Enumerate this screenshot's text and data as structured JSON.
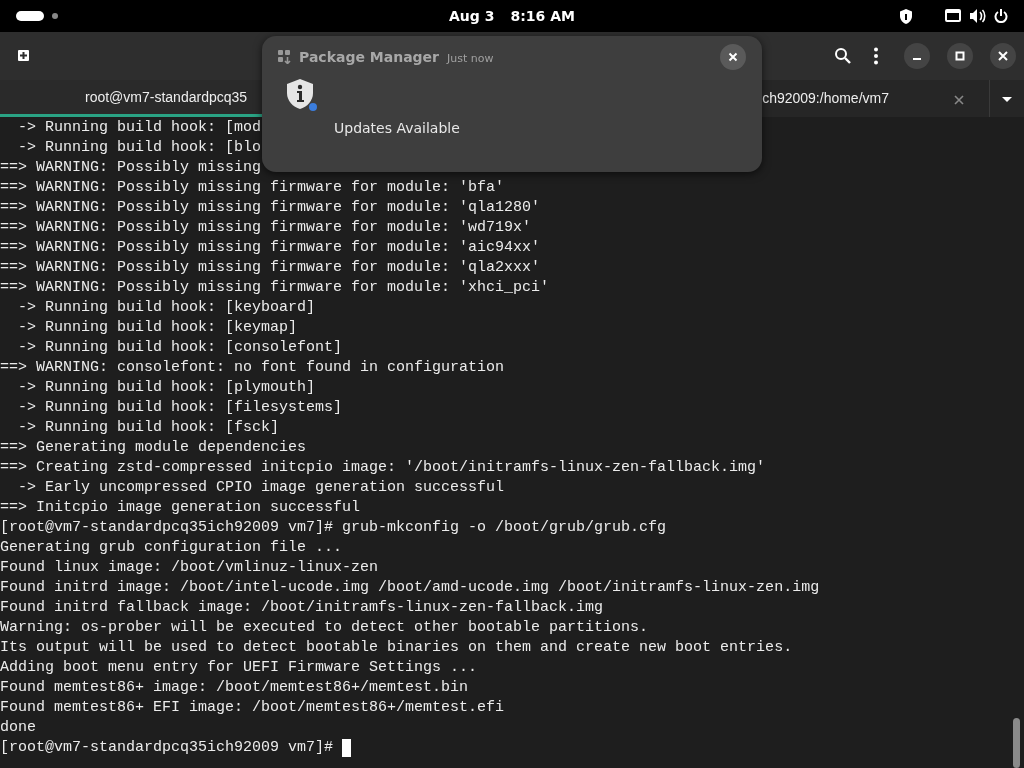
{
  "top_bar": {
    "date": "Aug 3",
    "time": "8:16 AM"
  },
  "tabs": [
    {
      "title": "root@vm7-standardpcq35",
      "selected": true
    },
    {
      "title": "ch92009:/home/vm7",
      "selected": false
    }
  ],
  "terminal": {
    "lines": [
      "  -> Running build hook: [mod",
      "  -> Running build hook: [blo",
      "==> WARNING: Possibly missing",
      "==> WARNING: Possibly missing firmware for module: 'bfa'",
      "==> WARNING: Possibly missing firmware for module: 'qla1280'",
      "==> WARNING: Possibly missing firmware for module: 'wd719x'",
      "==> WARNING: Possibly missing firmware for module: 'aic94xx'",
      "==> WARNING: Possibly missing firmware for module: 'qla2xxx'",
      "==> WARNING: Possibly missing firmware for module: 'xhci_pci'",
      "  -> Running build hook: [keyboard]",
      "  -> Running build hook: [keymap]",
      "  -> Running build hook: [consolefont]",
      "==> WARNING: consolefont: no font found in configuration",
      "  -> Running build hook: [plymouth]",
      "  -> Running build hook: [filesystems]",
      "  -> Running build hook: [fsck]",
      "==> Generating module dependencies",
      "==> Creating zstd-compressed initcpio image: '/boot/initramfs-linux-zen-fallback.img'",
      "  -> Early uncompressed CPIO image generation successful",
      "==> Initcpio image generation successful",
      "[root@vm7-standardpcq35ich92009 vm7]# grub-mkconfig -o /boot/grub/grub.cfg",
      "Generating grub configuration file ...",
      "Found linux image: /boot/vmlinuz-linux-zen",
      "Found initrd image: /boot/intel-ucode.img /boot/amd-ucode.img /boot/initramfs-linux-zen.img",
      "Found initrd fallback image: /boot/initramfs-linux-zen-fallback.img",
      "Warning: os-prober will be executed to detect other bootable partitions.",
      "Its output will be used to detect bootable binaries on them and create new boot entries.",
      "Adding boot menu entry for UEFI Firmware Settings ...",
      "Found memtest86+ image: /boot/memtest86+/memtest.bin",
      "Found memtest86+ EFI image: /boot/memtest86+/memtest.efi",
      "done"
    ],
    "prompt": "[root@vm7-standardpcq35ich92009 vm7]#"
  },
  "notification": {
    "app": "Package Manager",
    "time": "Just now",
    "body": "Updates Available"
  }
}
